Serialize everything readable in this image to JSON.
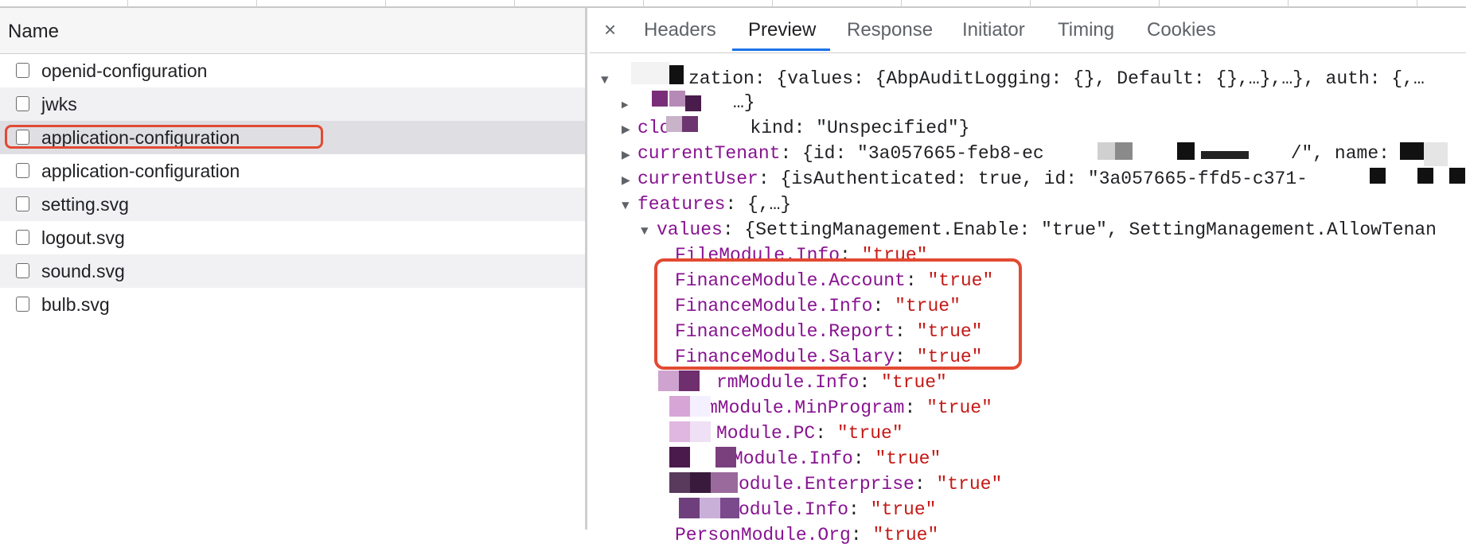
{
  "network_panel": {
    "column_header": "Name",
    "requests": [
      {
        "name": "openid-configuration"
      },
      {
        "name": "jwks"
      },
      {
        "name": "application-configuration"
      },
      {
        "name": "application-configuration"
      },
      {
        "name": "setting.svg"
      },
      {
        "name": "logout.svg"
      },
      {
        "name": "sound.svg"
      },
      {
        "name": "bulb.svg"
      }
    ]
  },
  "details_panel": {
    "close_label": "×",
    "tabs": [
      "Headers",
      "Preview",
      "Response",
      "Initiator",
      "Timing",
      "Cookies"
    ],
    "active_tab": "Preview"
  },
  "preview_tree": {
    "line1_key": "zation",
    "line1_value": ": {values: {AbpAuditLogging: {}, Default: {},…},…}, auth: {,…",
    "line2_value": "…}",
    "line3_key": "clo",
    "line3_value": "kind: \"Unspecified\"}",
    "line4_key": "currentTenant",
    "line4_value": ": {id: \"3a057665-feb8-ec",
    "line4_tail": "/\", name: '",
    "line5_key": "currentUser",
    "line5_value": ": {isAuthenticated: true, id: \"3a057665-ffd5-c371-",
    "line6_key": "features",
    "line6_value": ": {,…}",
    "line7_key": "values",
    "line7_value": ": {SettingManagement.Enable: \"true\", SettingManagement.AllowTenan",
    "entries": [
      {
        "key": "FileModule.Info",
        "value": "\"true\""
      },
      {
        "key": "FinanceModule.Account",
        "value": "\"true\""
      },
      {
        "key": "FinanceModule.Info",
        "value": "\"true\""
      },
      {
        "key": "FinanceModule.Report",
        "value": "\"true\""
      },
      {
        "key": "FinanceModule.Salary",
        "value": "\"true\""
      },
      {
        "key": "rmModule.Info",
        "value": "\"true\""
      },
      {
        "key": "mModule.MinProgram",
        "value": "\"true\""
      },
      {
        "key": "Module.PC",
        "value": "\"true\""
      },
      {
        "key": "Module.Info",
        "value": "\"true\""
      },
      {
        "key": "odule.Enterprise",
        "value": "\"true\""
      },
      {
        "key": "odule.Info",
        "value": "\"true\""
      },
      {
        "key": "PersonModule.Org",
        "value": "\"true\""
      }
    ]
  },
  "colors": {
    "highlight": "#e24a33",
    "json_key": "#881391",
    "json_string": "#c41a16",
    "active_tab_underline": "#1a73e8"
  }
}
